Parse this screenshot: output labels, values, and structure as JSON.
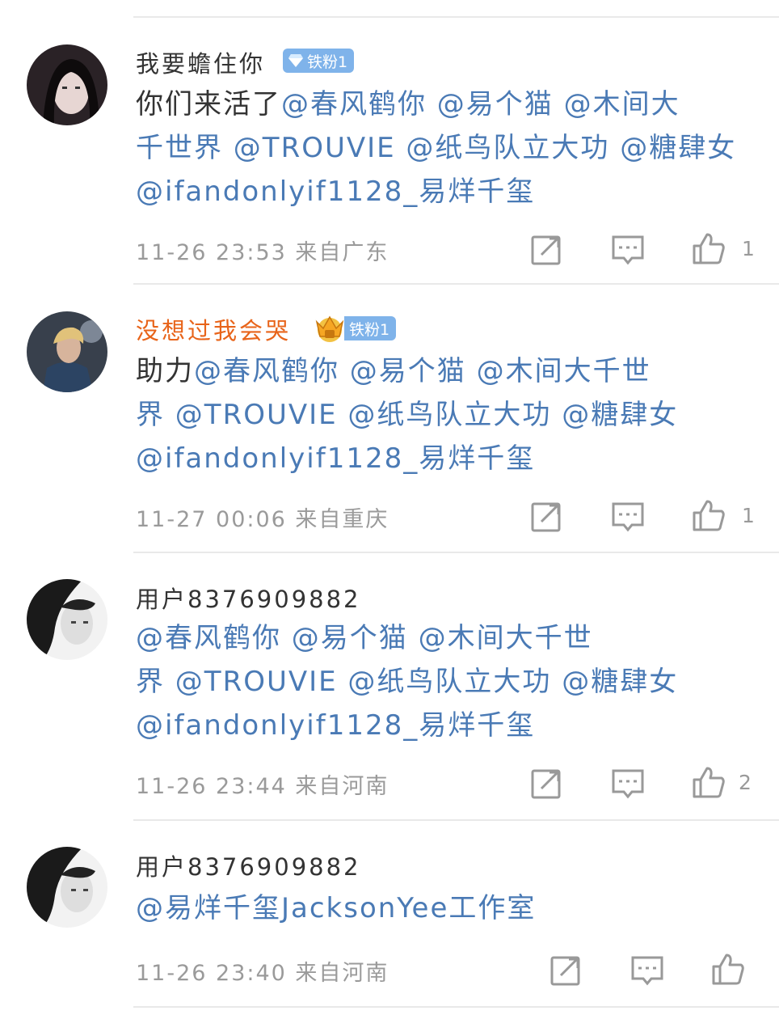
{
  "comments": [
    {
      "username": "我要蟾住你",
      "badge": "铁粉1",
      "lines": [
        [
          {
            "t": "你们来活了",
            "m": false
          },
          {
            "t": "@春风鹤你 @易个猫 @木间大",
            "m": true
          }
        ],
        [
          {
            "t": "千世界 @TROUVIE @纸鸟队立大功 @糖肆女",
            "m": true
          }
        ],
        [
          {
            "t": "@ifandonlyif1128_易烊千玺",
            "m": true
          }
        ]
      ],
      "time": "11-26 23:53  来自广东",
      "likes": "1"
    },
    {
      "username": "没想过我会哭",
      "badge": "铁粉1",
      "lines": [
        [
          {
            "t": "助力",
            "m": false
          },
          {
            "t": "@春风鹤你 @易个猫 @木间大千世",
            "m": true
          }
        ],
        [
          {
            "t": "界 @TROUVIE @纸鸟队立大功 @糖肆女",
            "m": true
          }
        ],
        [
          {
            "t": "@ifandonlyif1128_易烊千玺",
            "m": true
          }
        ]
      ],
      "time": "11-27 00:06  来自重庆",
      "likes": "1"
    },
    {
      "username": "用户8376909882",
      "badge": "",
      "lines": [
        [
          {
            "t": "@春风鹤你 @易个猫 @木间大千世",
            "m": true
          }
        ],
        [
          {
            "t": "界 @TROUVIE @纸鸟队立大功 @糖肆女",
            "m": true
          }
        ],
        [
          {
            "t": "@ifandonlyif1128_易烊千玺",
            "m": true
          }
        ]
      ],
      "time": "11-26 23:44  来自河南",
      "likes": "2"
    },
    {
      "username": "用户8376909882",
      "badge": "",
      "lines": [
        [
          {
            "t": "@易烊千玺JacksonYee工作室",
            "m": true
          }
        ]
      ],
      "time": "11-26 23:40  来自河南",
      "likes": ""
    }
  ],
  "colors": {
    "mention": "#4a7ab5",
    "username_vip": "#e8641a",
    "badge": "#7fb3ea",
    "meta": "#9a9a9a"
  },
  "icons": {
    "action_share": "share-edit-icon",
    "action_reply": "comment-bubble-icon",
    "action_like": "thumbs-up-icon"
  }
}
